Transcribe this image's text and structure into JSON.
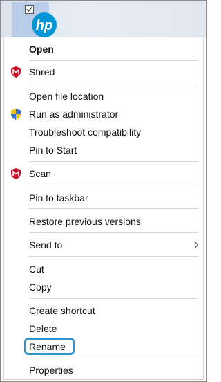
{
  "desktop": {
    "icon_name": "hp-logo-icon",
    "icon_text": "hp",
    "checkbox_checked": true,
    "accent": "#0096d6"
  },
  "menu": {
    "open": "Open",
    "shred": "Shred",
    "open_file_location": "Open file location",
    "run_as_admin": "Run as administrator",
    "troubleshoot": "Troubleshoot compatibility",
    "pin_to_start": "Pin to Start",
    "scan": "Scan",
    "pin_to_taskbar": "Pin to taskbar",
    "restore_previous": "Restore previous versions",
    "send_to": "Send to",
    "cut": "Cut",
    "copy": "Copy",
    "create_shortcut": "Create shortcut",
    "delete": "Delete",
    "rename": "Rename",
    "properties": "Properties"
  },
  "icons": {
    "shred": "mcafee-shield-icon",
    "run_as_admin": "uac-shield-icon",
    "scan": "mcafee-shield-icon",
    "send_to": "chevron-right-icon"
  },
  "highlight_color": "#2a95d1"
}
